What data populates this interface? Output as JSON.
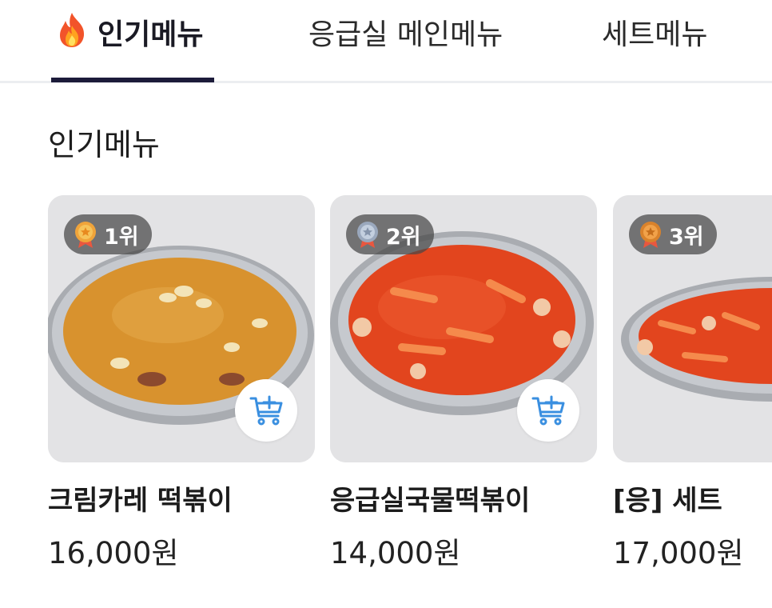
{
  "tabs": [
    {
      "label": "인기메뉴",
      "icon": "fire-icon",
      "active": true
    },
    {
      "label": "응급실 메인메뉴",
      "active": false
    },
    {
      "label": "세트메뉴",
      "active": false
    }
  ],
  "section": {
    "title": "인기메뉴"
  },
  "products": [
    {
      "rank": "1위",
      "medal": "gold-medal-icon",
      "name": "크림카레 떡볶이",
      "price": "16,000원",
      "sauce_color": "#d8922e"
    },
    {
      "rank": "2위",
      "medal": "silver-medal-icon",
      "name": "응급실국물떡볶이",
      "price": "14,000원",
      "sauce_color": "#e2451e"
    },
    {
      "rank": "3위",
      "medal": "bronze-medal-icon",
      "name": "[응] 세트",
      "price": "17,000원",
      "sauce_color": "#e2451e"
    }
  ],
  "colors": {
    "accent": "#1c1b3a",
    "cart_icon": "#3a8fe0"
  }
}
